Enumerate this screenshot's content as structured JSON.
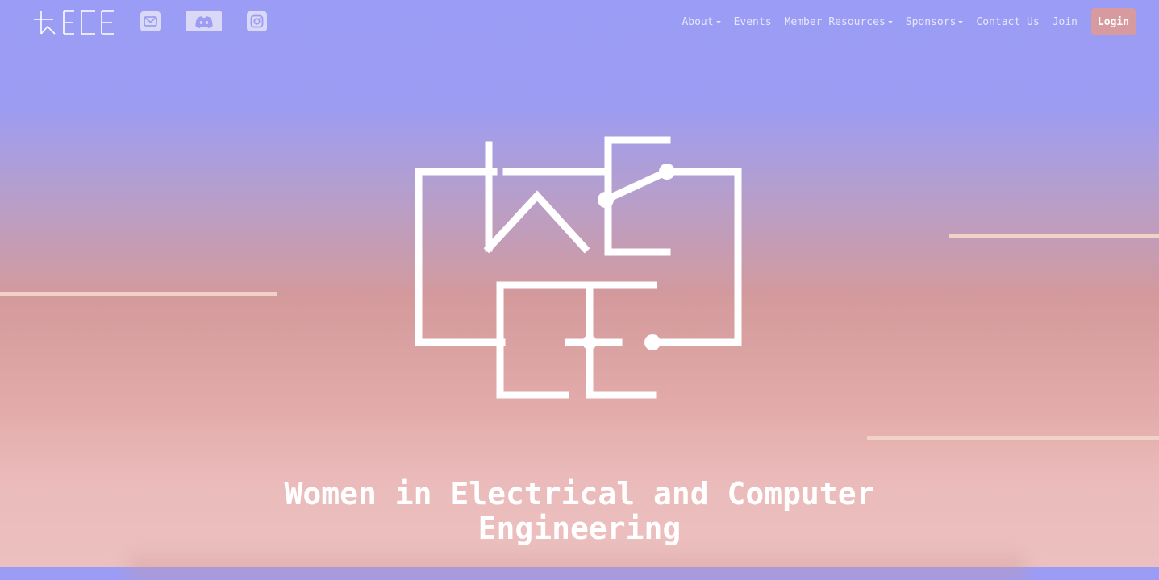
{
  "brand": {
    "logo_text": "WECE"
  },
  "social": [
    {
      "icon": "mail-icon"
    },
    {
      "icon": "discord-icon"
    },
    {
      "icon": "instagram-icon"
    }
  ],
  "nav": {
    "items": [
      {
        "label": "About",
        "dropdown": true
      },
      {
        "label": "Events",
        "dropdown": false
      },
      {
        "label": "Member Resources",
        "dropdown": true
      },
      {
        "label": "Sponsors",
        "dropdown": true
      },
      {
        "label": "Contact Us",
        "dropdown": false
      },
      {
        "label": "Join",
        "dropdown": false
      }
    ],
    "login_label": "Login"
  },
  "hero": {
    "logo_text": "WECE",
    "headline_line1": "Women in Electrical and Computer",
    "headline_line2": "Engineering"
  },
  "colors": {
    "gradient_top": "#9b9cf5",
    "gradient_bottom": "#ecc0c0",
    "accent_line": "#f1d2c7",
    "login_button": "#d69a9f",
    "nav_text": "#e6e6fb"
  }
}
